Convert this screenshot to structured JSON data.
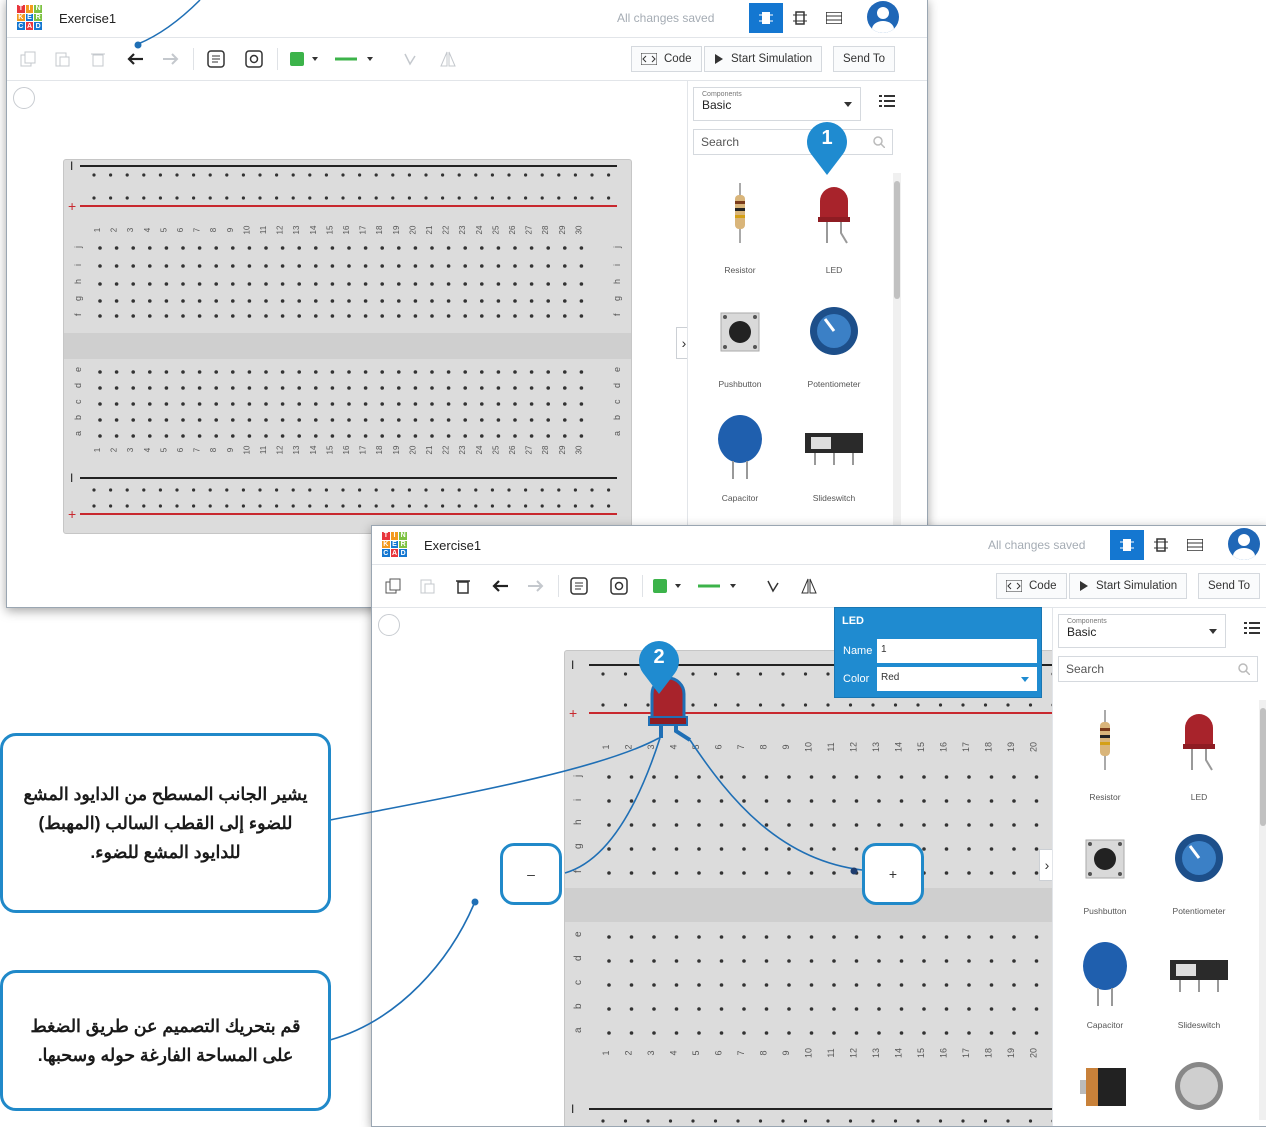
{
  "windows": [
    {
      "project_name": "Exercise1",
      "status": "All changes saved",
      "buttons": {
        "code": "Code",
        "start_simulation": "Start Simulation",
        "send_to": "Send To"
      },
      "sidebar": {
        "components_small": "Components",
        "components_value": "Basic",
        "search_placeholder": "Search",
        "components": [
          "Resistor",
          "LED",
          "Pushbutton",
          "Potentiometer",
          "Capacitor",
          "Slideswitch"
        ]
      }
    },
    {
      "project_name": "Exercise1",
      "status": "All changes saved",
      "buttons": {
        "code": "Code",
        "start_simulation": "Start Simulation",
        "send_to": "Send To"
      },
      "sidebar": {
        "components_small": "Components",
        "components_value": "Basic",
        "search_placeholder": "Search",
        "components": [
          "Resistor",
          "LED",
          "Pushbutton",
          "Potentiometer",
          "Capacitor",
          "Slideswitch"
        ]
      }
    }
  ],
  "breadboard": {
    "row_letters": [
      "j",
      "i",
      "h",
      "g",
      "f",
      "e",
      "d",
      "c",
      "b",
      "a"
    ],
    "columns": [
      "1",
      "2",
      "3",
      "4",
      "5",
      "6",
      "7",
      "8",
      "9",
      "10",
      "11",
      "12",
      "13",
      "14",
      "15",
      "16",
      "17",
      "18",
      "19",
      "20",
      "21",
      "22",
      "23",
      "24",
      "25",
      "26",
      "27",
      "28",
      "29",
      "30"
    ],
    "rail_plus": "+",
    "rail_minus": "I"
  },
  "inspector": {
    "title": "LED",
    "name_label": "Name",
    "name_value": "1",
    "color_label": "Color",
    "color_value": "Red"
  },
  "steps": [
    "1",
    "2"
  ],
  "pins": {
    "minus": "–",
    "plus": "+"
  },
  "callouts": {
    "flat_side": "يشير الجانب المسطح من الدايود المشع للضوء إلى القطب السالب (المهبط) للدايود المشع للضوء.",
    "move_design": "قم بتحريك التصميم عن طريق الضغط على المساحة الفارغة حوله وسحبها."
  },
  "colors": {
    "accent": "#1477d1",
    "callout_border": "#2089c9",
    "led": "#a8232b",
    "rail_red": "#c8282e"
  }
}
